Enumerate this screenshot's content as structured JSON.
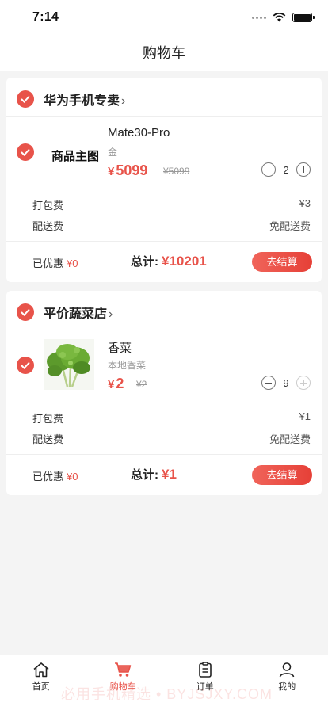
{
  "status_bar": {
    "time": "7:14"
  },
  "nav": {
    "title": "购物车"
  },
  "stores": [
    {
      "name": "华为手机专卖",
      "checked": true,
      "item": {
        "thumb_text": "商品主图",
        "name": "Mate30-Pro",
        "spec": "金",
        "price_symbol": "¥",
        "price": "5099",
        "old_price": "¥5099",
        "quantity": "2"
      },
      "fees": [
        {
          "label": "打包费",
          "value": "¥3"
        },
        {
          "label": "配送费",
          "value": "免配送费"
        }
      ],
      "saved_label": "已优惠",
      "saved_value": "¥0",
      "total_label": "总计:",
      "total_value": "¥10201",
      "checkout_label": "去结算"
    },
    {
      "name": "平价蔬菜店",
      "checked": true,
      "item": {
        "name": "香菜",
        "spec": "本地香菜",
        "price_symbol": "¥",
        "price": "2",
        "old_price": "¥2",
        "quantity": "9"
      },
      "fees": [
        {
          "label": "打包费",
          "value": "¥1"
        },
        {
          "label": "配送费",
          "value": "免配送费"
        }
      ],
      "saved_label": "已优惠",
      "saved_value": "¥0",
      "total_label": "总计:",
      "total_value": "¥1",
      "checkout_label": "去结算"
    }
  ],
  "tabs": [
    {
      "label": "首页",
      "icon": "home-icon"
    },
    {
      "label": "购物车",
      "icon": "cart-icon",
      "active": true
    },
    {
      "label": "订单",
      "icon": "order-icon"
    },
    {
      "label": "我的",
      "icon": "profile-icon"
    }
  ],
  "watermark": "必用手机精选 • BYJSJXY.COM",
  "colors": {
    "accent": "#e8534a",
    "background": "#f4f4f4"
  }
}
